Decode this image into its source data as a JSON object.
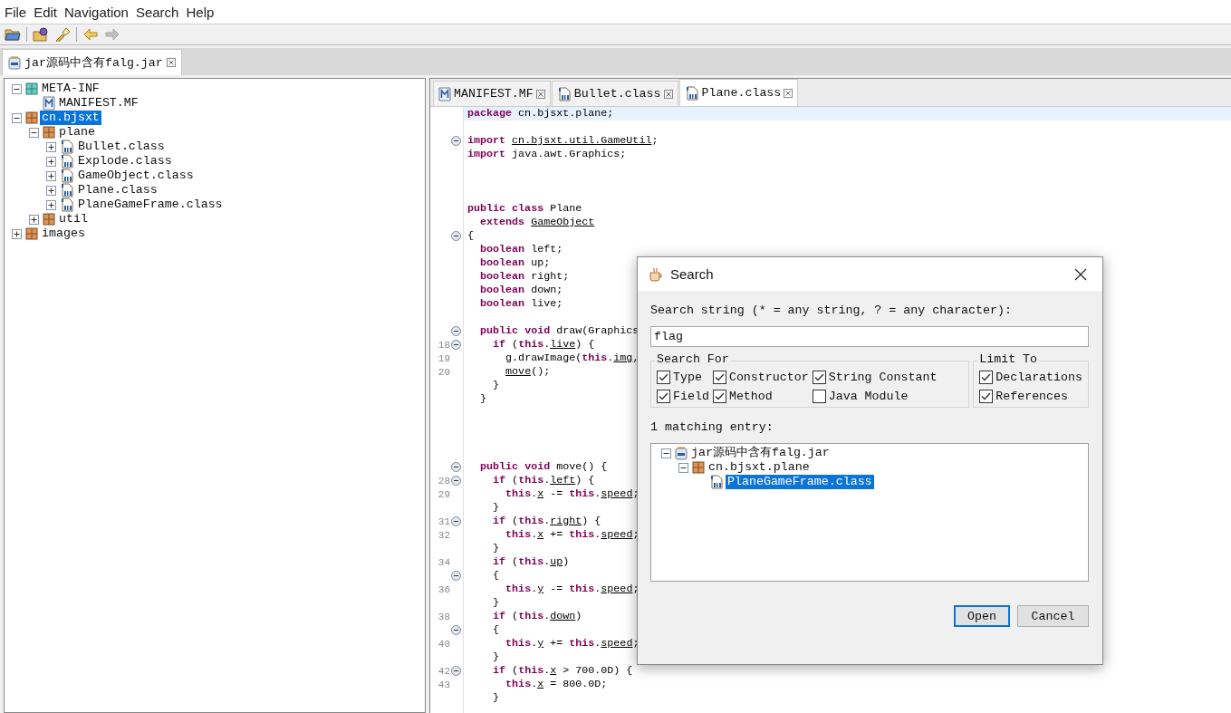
{
  "menu": [
    "File",
    "Edit",
    "Navigation",
    "Search",
    "Help"
  ],
  "toolbar": [
    {
      "kind": "open",
      "disabled": false
    },
    {
      "kind": "open-type",
      "disabled": false
    },
    {
      "kind": "search",
      "disabled": false
    },
    {
      "kind": "back",
      "disabled": false
    },
    {
      "kind": "forward",
      "disabled": true
    }
  ],
  "file_tabs": [
    {
      "label": "jar源码中含有falg.jar",
      "selected": true
    }
  ],
  "tree": [
    {
      "label": "META-INF",
      "kind": "folder",
      "expanded": true,
      "selected": false,
      "children": [
        {
          "label": "MANIFEST.MF",
          "kind": "manifest",
          "selected": false
        }
      ]
    },
    {
      "label": "cn.bjsxt",
      "kind": "package",
      "expanded": true,
      "selected": true,
      "children": [
        {
          "label": "plane",
          "kind": "package",
          "expanded": true,
          "selected": false,
          "children": [
            {
              "label": "Bullet.class",
              "kind": "class",
              "expanded": false,
              "selected": false
            },
            {
              "label": "Explode.class",
              "kind": "class",
              "expanded": false,
              "selected": false
            },
            {
              "label": "GameObject.class",
              "kind": "class",
              "expanded": false,
              "selected": false
            },
            {
              "label": "Plane.class",
              "kind": "class",
              "expanded": false,
              "selected": false
            },
            {
              "label": "PlaneGameFrame.class",
              "kind": "class",
              "expanded": false,
              "selected": false
            }
          ]
        },
        {
          "label": "util",
          "kind": "package",
          "expanded": false,
          "selected": false
        }
      ]
    },
    {
      "label": "images",
      "kind": "package",
      "expanded": false,
      "selected": false
    }
  ],
  "editor_tabs": [
    {
      "label": "MANIFEST.MF",
      "kind": "manifest",
      "selected": false
    },
    {
      "label": "Bullet.class",
      "kind": "class",
      "selected": false
    },
    {
      "label": "Plane.class",
      "kind": "class",
      "selected": true
    }
  ],
  "code": [
    {
      "kind": "code",
      "highlighted": true,
      "parts": [
        {
          "kind": "keyword",
          "text": "package "
        },
        {
          "kind": "plain",
          "text": "cn.bjsxt.plane;"
        }
      ]
    },
    {
      "kind": "blank"
    },
    {
      "kind": "code",
      "fold": true,
      "parts": [
        {
          "kind": "keyword",
          "text": "import "
        },
        {
          "kind": "ref",
          "text": "cn.bjsxt.util.GameUtil"
        },
        {
          "kind": "plain",
          "text": ";"
        }
      ]
    },
    {
      "kind": "code",
      "parts": [
        {
          "kind": "keyword",
          "text": "import "
        },
        {
          "kind": "plain",
          "text": "java.awt.Graphics;"
        }
      ]
    },
    {
      "kind": "blank"
    },
    {
      "kind": "blank"
    },
    {
      "kind": "blank"
    },
    {
      "kind": "code",
      "parts": [
        {
          "kind": "keyword",
          "text": "public class "
        },
        {
          "kind": "plain",
          "text": "Plane"
        }
      ]
    },
    {
      "kind": "code",
      "parts": [
        {
          "kind": "keyword",
          "text": "  extends "
        },
        {
          "kind": "ref",
          "text": "GameObject"
        }
      ]
    },
    {
      "kind": "code",
      "fold": true,
      "parts": [
        {
          "kind": "plain",
          "text": "{"
        }
      ]
    },
    {
      "kind": "code",
      "parts": [
        {
          "kind": "keyword",
          "text": "  boolean "
        },
        {
          "kind": "plain",
          "text": "left;"
        }
      ]
    },
    {
      "kind": "code",
      "parts": [
        {
          "kind": "keyword",
          "text": "  boolean "
        },
        {
          "kind": "plain",
          "text": "up;"
        }
      ]
    },
    {
      "kind": "code",
      "parts": [
        {
          "kind": "keyword",
          "text": "  boolean "
        },
        {
          "kind": "plain",
          "text": "right;"
        }
      ]
    },
    {
      "kind": "code",
      "parts": [
        {
          "kind": "keyword",
          "text": "  boolean "
        },
        {
          "kind": "plain",
          "text": "down;"
        }
      ]
    },
    {
      "kind": "code",
      "parts": [
        {
          "kind": "keyword",
          "text": "  boolean "
        },
        {
          "kind": "plain",
          "text": "live;"
        }
      ]
    },
    {
      "kind": "blank"
    },
    {
      "kind": "code",
      "fold": true,
      "parts": [
        {
          "kind": "keyword",
          "text": "  public void "
        },
        {
          "kind": "plain",
          "text": "draw(Graphics"
        }
      ]
    },
    {
      "kind": "code",
      "number": "18",
      "fold": true,
      "parts": [
        {
          "kind": "keyword",
          "text": "    if"
        },
        {
          "kind": "plain",
          "text": " ("
        },
        {
          "kind": "keyword",
          "text": "this"
        },
        {
          "kind": "plain",
          "text": "."
        },
        {
          "kind": "ref",
          "text": "live"
        },
        {
          "kind": "plain",
          "text": ") {"
        }
      ]
    },
    {
      "kind": "code",
      "number": "19",
      "parts": [
        {
          "kind": "plain",
          "text": "      g.drawImage("
        },
        {
          "kind": "keyword",
          "text": "this"
        },
        {
          "kind": "plain",
          "text": "."
        },
        {
          "kind": "ref",
          "text": "img"
        },
        {
          "kind": "plain",
          "text": ","
        }
      ]
    },
    {
      "kind": "code",
      "number": "20",
      "parts": [
        {
          "kind": "ref",
          "text": "      move"
        },
        {
          "kind": "plain",
          "text": "();"
        }
      ]
    },
    {
      "kind": "code",
      "parts": [
        {
          "kind": "plain",
          "text": "    }"
        }
      ]
    },
    {
      "kind": "code",
      "parts": [
        {
          "kind": "plain",
          "text": "  }"
        }
      ]
    },
    {
      "kind": "blank"
    },
    {
      "kind": "blank"
    },
    {
      "kind": "blank"
    },
    {
      "kind": "blank"
    },
    {
      "kind": "code",
      "fold": true,
      "parts": [
        {
          "kind": "keyword",
          "text": "  public void "
        },
        {
          "kind": "plain",
          "text": "move() {"
        }
      ]
    },
    {
      "kind": "code",
      "number": "28",
      "fold": true,
      "parts": [
        {
          "kind": "keyword",
          "text": "    if"
        },
        {
          "kind": "plain",
          "text": " ("
        },
        {
          "kind": "keyword",
          "text": "this"
        },
        {
          "kind": "plain",
          "text": "."
        },
        {
          "kind": "ref",
          "text": "left"
        },
        {
          "kind": "plain",
          "text": ") {"
        }
      ]
    },
    {
      "kind": "code",
      "number": "29",
      "parts": [
        {
          "kind": "keyword",
          "text": "      this"
        },
        {
          "kind": "plain",
          "text": "."
        },
        {
          "kind": "ref",
          "text": "x"
        },
        {
          "kind": "plain",
          "text": " -= "
        },
        {
          "kind": "keyword",
          "text": "this"
        },
        {
          "kind": "plain",
          "text": "."
        },
        {
          "kind": "ref",
          "text": "speed"
        },
        {
          "kind": "plain",
          "text": ";"
        }
      ]
    },
    {
      "kind": "code",
      "parts": [
        {
          "kind": "plain",
          "text": "    }"
        }
      ]
    },
    {
      "kind": "code",
      "number": "31",
      "fold": true,
      "parts": [
        {
          "kind": "keyword",
          "text": "    if"
        },
        {
          "kind": "plain",
          "text": " ("
        },
        {
          "kind": "keyword",
          "text": "this"
        },
        {
          "kind": "plain",
          "text": "."
        },
        {
          "kind": "ref",
          "text": "right"
        },
        {
          "kind": "plain",
          "text": ") {"
        }
      ]
    },
    {
      "kind": "code",
      "number": "32",
      "parts": [
        {
          "kind": "keyword",
          "text": "      this"
        },
        {
          "kind": "plain",
          "text": "."
        },
        {
          "kind": "ref",
          "text": "x"
        },
        {
          "kind": "plain",
          "text": " += "
        },
        {
          "kind": "keyword",
          "text": "this"
        },
        {
          "kind": "plain",
          "text": "."
        },
        {
          "kind": "ref",
          "text": "speed"
        },
        {
          "kind": "plain",
          "text": ";"
        }
      ]
    },
    {
      "kind": "code",
      "parts": [
        {
          "kind": "plain",
          "text": "    }"
        }
      ]
    },
    {
      "kind": "code",
      "number": "34",
      "parts": [
        {
          "kind": "keyword",
          "text": "    if"
        },
        {
          "kind": "plain",
          "text": " ("
        },
        {
          "kind": "keyword",
          "text": "this"
        },
        {
          "kind": "plain",
          "text": "."
        },
        {
          "kind": "ref",
          "text": "up"
        },
        {
          "kind": "plain",
          "text": ")"
        }
      ]
    },
    {
      "kind": "code",
      "fold": true,
      "parts": [
        {
          "kind": "plain",
          "text": "    {"
        }
      ]
    },
    {
      "kind": "code",
      "number": "36",
      "parts": [
        {
          "kind": "keyword",
          "text": "      this"
        },
        {
          "kind": "plain",
          "text": "."
        },
        {
          "kind": "ref",
          "text": "y"
        },
        {
          "kind": "plain",
          "text": " -= "
        },
        {
          "kind": "keyword",
          "text": "this"
        },
        {
          "kind": "plain",
          "text": "."
        },
        {
          "kind": "ref",
          "text": "speed"
        },
        {
          "kind": "plain",
          "text": ";"
        }
      ]
    },
    {
      "kind": "code",
      "parts": [
        {
          "kind": "plain",
          "text": "    }"
        }
      ]
    },
    {
      "kind": "code",
      "number": "38",
      "parts": [
        {
          "kind": "keyword",
          "text": "    if"
        },
        {
          "kind": "plain",
          "text": " ("
        },
        {
          "kind": "keyword",
          "text": "this"
        },
        {
          "kind": "plain",
          "text": "."
        },
        {
          "kind": "ref",
          "text": "down"
        },
        {
          "kind": "plain",
          "text": ")"
        }
      ]
    },
    {
      "kind": "code",
      "fold": true,
      "parts": [
        {
          "kind": "plain",
          "text": "    {"
        }
      ]
    },
    {
      "kind": "code",
      "number": "40",
      "parts": [
        {
          "kind": "keyword",
          "text": "      this"
        },
        {
          "kind": "plain",
          "text": "."
        },
        {
          "kind": "ref",
          "text": "y"
        },
        {
          "kind": "plain",
          "text": " += "
        },
        {
          "kind": "keyword",
          "text": "this"
        },
        {
          "kind": "plain",
          "text": "."
        },
        {
          "kind": "ref",
          "text": "speed"
        },
        {
          "kind": "plain",
          "text": ";"
        }
      ]
    },
    {
      "kind": "code",
      "parts": [
        {
          "kind": "plain",
          "text": "    }"
        }
      ]
    },
    {
      "kind": "code",
      "number": "42",
      "fold": true,
      "parts": [
        {
          "kind": "keyword",
          "text": "    if"
        },
        {
          "kind": "plain",
          "text": " ("
        },
        {
          "kind": "keyword",
          "text": "this"
        },
        {
          "kind": "plain",
          "text": "."
        },
        {
          "kind": "ref",
          "text": "x"
        },
        {
          "kind": "plain",
          "text": " > 700.0D) {"
        }
      ]
    },
    {
      "kind": "code",
      "number": "43",
      "parts": [
        {
          "kind": "keyword",
          "text": "      this"
        },
        {
          "kind": "plain",
          "text": "."
        },
        {
          "kind": "ref",
          "text": "x"
        },
        {
          "kind": "plain",
          "text": " = 800.0D;"
        }
      ]
    },
    {
      "kind": "code",
      "parts": [
        {
          "kind": "plain",
          "text": "    }"
        }
      ]
    }
  ],
  "dialog": {
    "title": "Search",
    "prompt": "Search string (* = any string, ? = any character):",
    "search_value": "flag",
    "search_for": {
      "title": "Search For",
      "options": [
        {
          "label": "Type",
          "checked": true
        },
        {
          "label": "Constructor",
          "checked": true
        },
        {
          "label": "String Constant",
          "checked": true
        },
        {
          "label": "Field",
          "checked": true
        },
        {
          "label": "Method",
          "checked": true
        },
        {
          "label": "Java Module",
          "checked": false
        }
      ]
    },
    "limit_to": {
      "title": "Limit To",
      "options": [
        {
          "label": "Declarations",
          "checked": true
        },
        {
          "label": "References",
          "checked": true
        }
      ]
    },
    "result_count": "1 matching entry:",
    "results": [
      {
        "label": "jar源码中含有falg.jar",
        "kind": "jar",
        "expanded": true,
        "selected": false,
        "children": [
          {
            "label": "cn.bjsxt.plane",
            "kind": "package",
            "expanded": true,
            "selected": false,
            "children": [
              {
                "label": "PlaneGameFrame.class",
                "kind": "class",
                "selected": true
              }
            ]
          }
        ]
      }
    ],
    "buttons": [
      {
        "label": "Open",
        "default": true
      },
      {
        "label": "Cancel",
        "default": false
      }
    ]
  }
}
